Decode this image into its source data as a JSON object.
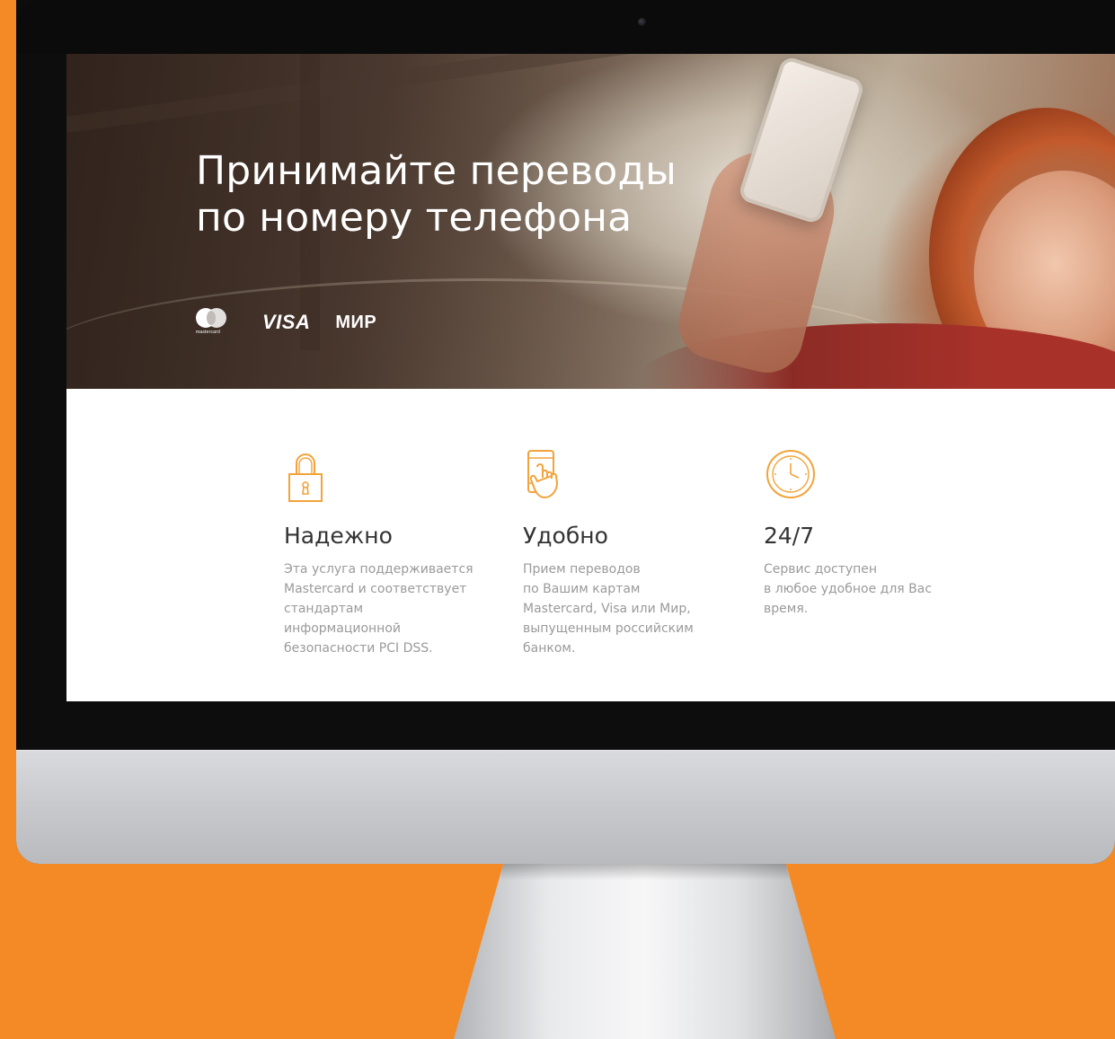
{
  "hero": {
    "title_line1": "Принимайте переводы",
    "title_line2": "по номеру телефона",
    "mastercard_label": "mastercard",
    "visa_label": "VISA",
    "mir_label": "МИР"
  },
  "features": [
    {
      "icon": "padlock-icon",
      "title": "Надежно",
      "lines": [
        "Эта услуга поддерживается",
        "Mastercard и соответствует",
        "стандартам",
        "информационной",
        "безопасности PCI DSS."
      ]
    },
    {
      "icon": "phone-touch-icon",
      "title": "Удобно",
      "lines": [
        "Прием переводов",
        "по Вашим картам",
        "Mastercard, Visa или Мир,",
        "выпущенным российским",
        "банком."
      ]
    },
    {
      "icon": "clock-icon",
      "title": "24/7",
      "lines": [
        "Сервис доступен",
        "в любое удобное для Вас",
        "время."
      ]
    }
  ],
  "colors": {
    "background": "#f48a26",
    "accent": "#f2a33a",
    "heading": "#333333",
    "body_text": "#9a9a9a"
  }
}
